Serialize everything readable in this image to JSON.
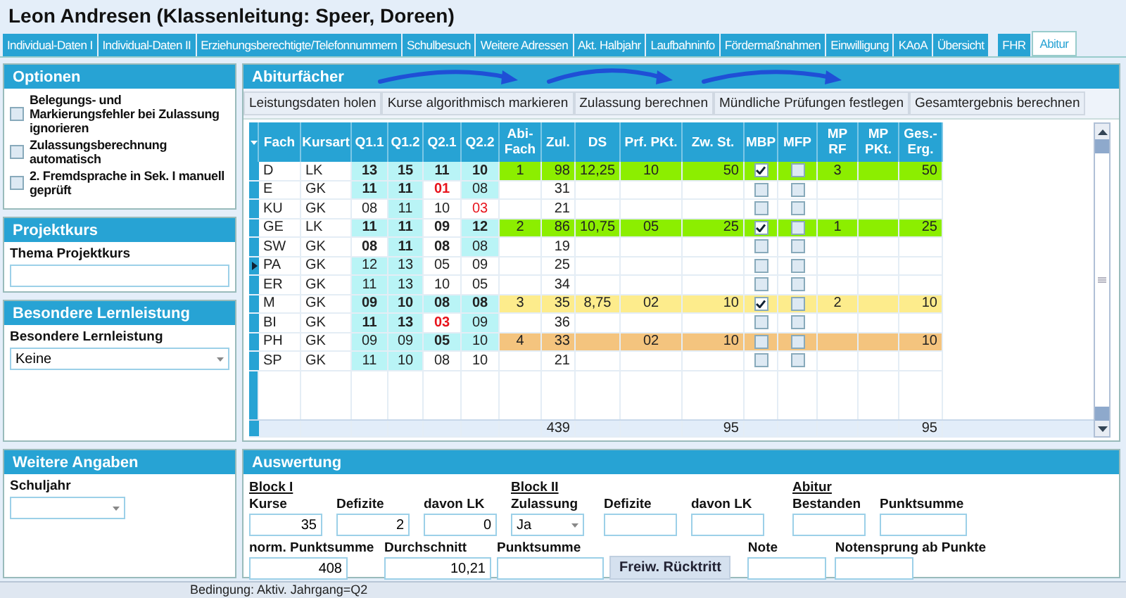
{
  "window": {
    "title": "Leon Andresen (Klassenleitung: Speer, Doreen)"
  },
  "tabs": [
    {
      "label": "Individual-Daten I",
      "selected": false
    },
    {
      "label": "Individual-Daten II",
      "selected": false
    },
    {
      "label": "Erziehungsberechtigte/Telefonnummern",
      "selected": false
    },
    {
      "label": "Schulbesuch",
      "selected": false
    },
    {
      "label": "Weitere Adressen",
      "selected": false
    },
    {
      "label": "Akt. Halbjahr",
      "selected": false
    },
    {
      "label": "Laufbahninfo",
      "selected": false
    },
    {
      "label": "Fördermaßnahmen",
      "selected": false
    },
    {
      "label": "Einwilligung",
      "selected": false
    },
    {
      "label": "KAoA",
      "selected": false
    },
    {
      "label": "Übersicht",
      "selected": false
    },
    {
      "label": "FHR",
      "selected": false
    },
    {
      "label": "Abitur",
      "selected": true
    }
  ],
  "optionen": {
    "title": "Optionen",
    "options": [
      {
        "label": "Belegungs- und Markierungsfehler bei Zulassung ignorieren",
        "checked": false
      },
      {
        "label": "Zulassungsberechnung automatisch",
        "checked": false
      },
      {
        "label": "2. Fremdsprache in Sek. I manuell geprüft",
        "checked": false
      }
    ]
  },
  "projektkurs": {
    "title": "Projektkurs",
    "label": "Thema Projektkurs"
  },
  "besondere_lernleistung": {
    "title": "Besondere Lernleistung",
    "label": "Besondere Lernleistung",
    "value": "Keine"
  },
  "weitere_angaben": {
    "title": "Weitere Angaben",
    "label": "Schuljahr"
  },
  "abiturfaecher": {
    "title": "Abiturfächer",
    "actions": [
      "Leistungsdaten holen",
      "Kurse algorithmisch markieren",
      "Zulassung berechnen",
      "Mündliche Prüfungen festlegen",
      "Gesamtergebnis berechnen"
    ],
    "columns": [
      "Fach",
      "Kursart",
      "Q1.1",
      "Q1.2",
      "Q2.1",
      "Q2.2",
      "Abi-Fach",
      "Zul.",
      "DS",
      "Prf. PKt.",
      "Zw. St.",
      "MBP",
      "MFP",
      "MP RF",
      "MP PKt.",
      "Ges.- Erg."
    ],
    "rows": [
      {
        "fach": "D",
        "kursart": "LK",
        "current": false,
        "color": "#8cee00",
        "grades": [
          {
            "value": "13",
            "counted": true,
            "marked": true,
            "deficit": false
          },
          {
            "value": "15",
            "counted": true,
            "marked": true,
            "deficit": false
          },
          {
            "value": "11",
            "counted": true,
            "marked": true,
            "deficit": false
          },
          {
            "value": "10",
            "counted": true,
            "marked": true,
            "deficit": false
          }
        ],
        "abi_fach": "1",
        "zul": "98",
        "ds": "12,25",
        "prf_pkt": "10",
        "zw_st": "50",
        "mbp": true,
        "mfp": false,
        "mp_rf": "3",
        "mp_pkt": "",
        "ges_erg": "50"
      },
      {
        "fach": "E",
        "kursart": "GK",
        "current": false,
        "grades": [
          {
            "value": "11",
            "counted": true,
            "marked": true,
            "deficit": false
          },
          {
            "value": "11",
            "counted": true,
            "marked": true,
            "deficit": false
          },
          {
            "value": "01",
            "counted": true,
            "marked": false,
            "deficit": true
          },
          {
            "value": "08",
            "counted": false,
            "marked": true,
            "deficit": false
          }
        ],
        "zul": "31",
        "mbp": false,
        "mfp": false
      },
      {
        "fach": "KU",
        "kursart": "GK",
        "current": false,
        "grades": [
          {
            "value": "08",
            "counted": false,
            "marked": false,
            "deficit": false
          },
          {
            "value": "11",
            "counted": false,
            "marked": true,
            "deficit": false
          },
          {
            "value": "10",
            "counted": false,
            "marked": false,
            "deficit": false
          },
          {
            "value": "03",
            "counted": false,
            "marked": false,
            "deficit": true
          }
        ],
        "zul": "21",
        "mbp": false,
        "mfp": false
      },
      {
        "fach": "GE",
        "kursart": "LK",
        "current": false,
        "color": "#8cee00",
        "grades": [
          {
            "value": "11",
            "counted": true,
            "marked": true,
            "deficit": false
          },
          {
            "value": "11",
            "counted": true,
            "marked": true,
            "deficit": false
          },
          {
            "value": "09",
            "counted": true,
            "marked": false,
            "deficit": false
          },
          {
            "value": "12",
            "counted": true,
            "marked": true,
            "deficit": false
          }
        ],
        "abi_fach": "2",
        "zul": "86",
        "ds": "10,75",
        "prf_pkt": "05",
        "zw_st": "25",
        "mbp": true,
        "mfp": false,
        "mp_rf": "1",
        "ges_erg": "25"
      },
      {
        "fach": "SW",
        "kursart": "GK",
        "current": false,
        "grades": [
          {
            "value": "08",
            "counted": true,
            "marked": false,
            "deficit": false
          },
          {
            "value": "11",
            "counted": true,
            "marked": true,
            "deficit": false
          },
          {
            "value": "08",
            "counted": true,
            "marked": false,
            "deficit": false
          },
          {
            "value": "08",
            "counted": false,
            "marked": true,
            "deficit": false
          }
        ],
        "zul": "19",
        "mbp": false,
        "mfp": false
      },
      {
        "fach": "PA",
        "kursart": "GK",
        "current": true,
        "grades": [
          {
            "value": "12",
            "counted": false,
            "marked": true,
            "deficit": false
          },
          {
            "value": "13",
            "counted": false,
            "marked": true,
            "deficit": false
          },
          {
            "value": "05",
            "counted": false,
            "marked": false,
            "deficit": false
          },
          {
            "value": "09",
            "counted": false,
            "marked": false,
            "deficit": false
          }
        ],
        "zul": "25",
        "mbp": false,
        "mfp": false
      },
      {
        "fach": "ER",
        "kursart": "GK",
        "current": false,
        "grades": [
          {
            "value": "11",
            "counted": false,
            "marked": true,
            "deficit": false
          },
          {
            "value": "13",
            "counted": false,
            "marked": true,
            "deficit": false
          },
          {
            "value": "10",
            "counted": false,
            "marked": false,
            "deficit": false
          },
          {
            "value": "05",
            "counted": false,
            "marked": false,
            "deficit": false
          }
        ],
        "zul": "34",
        "mbp": false,
        "mfp": false
      },
      {
        "fach": "M",
        "kursart": "GK",
        "current": false,
        "color": "#fdec8c",
        "grades": [
          {
            "value": "09",
            "counted": true,
            "marked": true,
            "deficit": false
          },
          {
            "value": "10",
            "counted": true,
            "marked": true,
            "deficit": false
          },
          {
            "value": "08",
            "counted": true,
            "marked": true,
            "deficit": false
          },
          {
            "value": "08",
            "counted": true,
            "marked": true,
            "deficit": false
          }
        ],
        "abi_fach": "3",
        "zul": "35",
        "ds": "8,75",
        "prf_pkt": "02",
        "zw_st": "10",
        "mbp": true,
        "mfp": false,
        "mp_rf": "2",
        "ges_erg": "10"
      },
      {
        "fach": "BI",
        "kursart": "GK",
        "current": false,
        "grades": [
          {
            "value": "11",
            "counted": true,
            "marked": true,
            "deficit": false
          },
          {
            "value": "13",
            "counted": true,
            "marked": true,
            "deficit": false
          },
          {
            "value": "03",
            "counted": true,
            "marked": false,
            "deficit": true
          },
          {
            "value": "09",
            "counted": false,
            "marked": true,
            "deficit": false
          }
        ],
        "zul": "36",
        "mbp": false,
        "mfp": false
      },
      {
        "fach": "PH",
        "kursart": "GK",
        "current": false,
        "color": "#f4c47e",
        "grades": [
          {
            "value": "09",
            "counted": false,
            "marked": true,
            "deficit": false
          },
          {
            "value": "09",
            "counted": false,
            "marked": true,
            "deficit": false
          },
          {
            "value": "05",
            "counted": true,
            "marked": true,
            "deficit": false
          },
          {
            "value": "10",
            "counted": false,
            "marked": true,
            "deficit": false
          }
        ],
        "abi_fach": "4",
        "zul": "33",
        "prf_pkt": "02",
        "zw_st": "10",
        "mbp": false,
        "mfp": false,
        "ges_erg": "10"
      },
      {
        "fach": "SP",
        "kursart": "GK",
        "current": false,
        "grades": [
          {
            "value": "11",
            "counted": false,
            "marked": true,
            "deficit": false
          },
          {
            "value": "10",
            "counted": false,
            "marked": true,
            "deficit": false
          },
          {
            "value": "08",
            "counted": false,
            "marked": false,
            "deficit": false
          },
          {
            "value": "10",
            "counted": false,
            "marked": false,
            "deficit": false
          }
        ],
        "zul": "21",
        "mbp": false,
        "mfp": false
      }
    ],
    "totals": {
      "zul": "439",
      "zw_st": "95",
      "ges_erg": "95"
    }
  },
  "auswertung": {
    "title": "Auswertung",
    "row_1": [
      {
        "heading": "Block I",
        "label": "Kurse",
        "kind": "field",
        "value": "35"
      },
      {
        "label": "Defizite",
        "kind": "field",
        "value": "2"
      },
      {
        "label": "davon LK",
        "kind": "field",
        "value": "0"
      },
      {
        "heading": "Block II",
        "label": "Zulassung",
        "kind": "select",
        "value": "Ja"
      },
      {
        "label": "Defizite",
        "kind": "field"
      },
      {
        "label": "davon LK",
        "kind": "field"
      },
      {
        "heading": "Abitur",
        "label": "Bestanden",
        "kind": "field"
      },
      {
        "label": "Punktsumme",
        "kind": "field"
      }
    ],
    "row_2": [
      {
        "label": "norm. Punktsumme",
        "kind": "field",
        "value": "408"
      },
      {
        "label": "Durchschnitt",
        "kind": "field",
        "value": "10,21"
      },
      {
        "label": "Punktsumme",
        "kind": "field"
      },
      {
        "label": "Freiw. Rücktritt",
        "kind": "button"
      },
      {
        "label": "Note",
        "kind": "field"
      },
      {
        "label": "Notensprung ab Punkte",
        "kind": "field"
      }
    ]
  },
  "status_bar": {
    "text": "Bedingung: Aktiv. Jahrgang=Q2"
  }
}
